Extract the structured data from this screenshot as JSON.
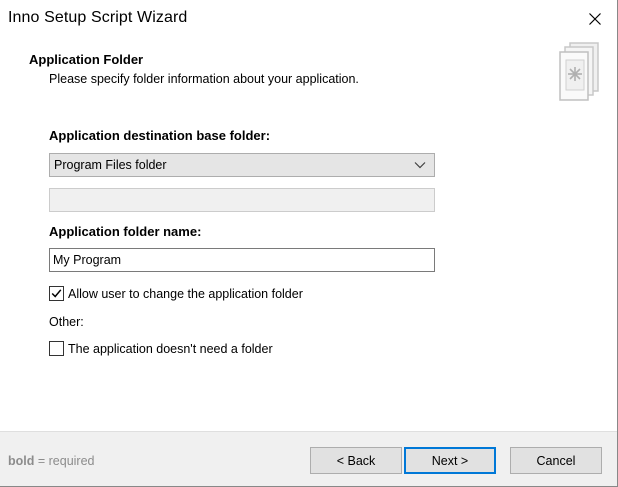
{
  "window": {
    "title": "Inno Setup Script Wizard"
  },
  "header": {
    "title": "Application Folder",
    "description": "Please specify folder information about your application.",
    "icon": "wizard-page-icon"
  },
  "form": {
    "base_folder_label": "Application destination base folder:",
    "base_folder_selected": "Program Files folder",
    "custom_folder_value": "",
    "folder_name_label": "Application folder name:",
    "folder_name_value": "My Program",
    "allow_change_label": "Allow user to change the application folder",
    "allow_change_checked": true,
    "other_label": "Other:",
    "no_folder_label": "The application doesn't need a folder",
    "no_folder_checked": false
  },
  "footer": {
    "hint_bold": "bold",
    "hint_rest": " = required",
    "back_label": "< Back",
    "next_label": "Next >",
    "cancel_label": "Cancel"
  },
  "colors": {
    "accent": "#0078d7",
    "footer_bg": "#f0f0f0",
    "hint_text": "#8c8c8c"
  }
}
